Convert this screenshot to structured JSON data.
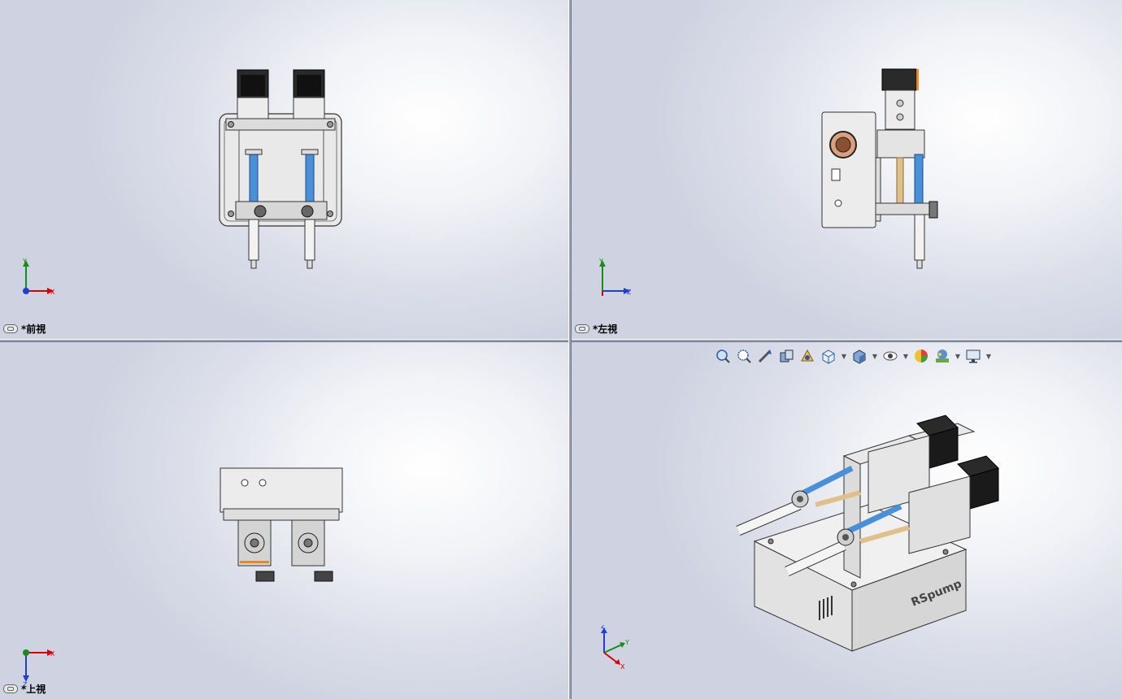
{
  "views": {
    "front": {
      "label": "*前視",
      "triad_axes": [
        "Y",
        "X"
      ]
    },
    "left": {
      "label": "*左視",
      "triad_axes": [
        "Y",
        "Z"
      ]
    },
    "top": {
      "label": "*上視",
      "triad_axes": [
        "X",
        "Z"
      ]
    },
    "iso": {
      "triad_axes": [
        "Z",
        "Y",
        "X"
      ],
      "body_text": "RSpump"
    }
  },
  "heads_up_toolbar": [
    "zoom-to-fit-icon",
    "zoom-to-area-icon",
    "previous-view-icon",
    "section-view-icon",
    "dynamic-annotation-icon",
    "view-orientation-icon",
    "display-style-icon",
    "hide-show-items-icon",
    "edit-appearance-icon",
    "apply-scene-icon",
    "view-settings-icon"
  ],
  "colors": {
    "axis_x": "#d40000",
    "axis_y": "#1a8c1a",
    "axis_z": "#1f3fd4",
    "syringe": "#4a90d9",
    "accent": "#e8891c"
  }
}
